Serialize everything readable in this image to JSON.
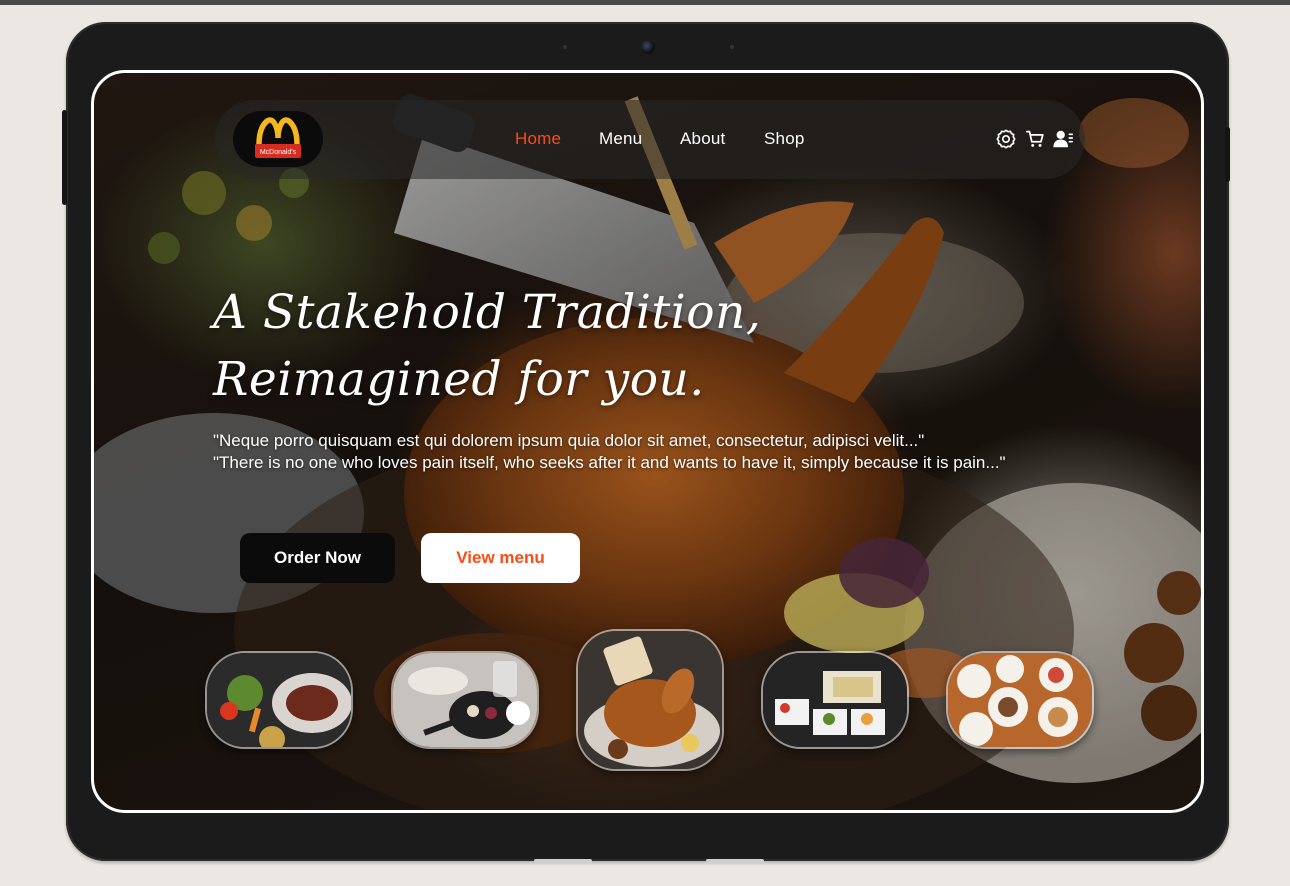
{
  "brand": {
    "logo_text": "McDonald's",
    "logo_icon": "golden-arches-icon"
  },
  "nav": {
    "items": [
      {
        "label": "Home",
        "active": true
      },
      {
        "label": "Menu",
        "active": false
      },
      {
        "label": "About",
        "active": false
      },
      {
        "label": "Shop",
        "active": false
      }
    ],
    "icons": [
      "settings-icon",
      "cart-icon",
      "user-icon"
    ]
  },
  "hero": {
    "title_line1": "A Stakehold Tradition,",
    "title_line2": "Reimagined for you.",
    "quote_line1": "\"Neque porro quisquam est qui dolorem ipsum quia dolor sit amet, consectetur, adipisci velit...\"",
    "quote_line2": "\"There is no one who loves pain itself, who seeks after it and wants to have it, simply because it is pain...\""
  },
  "actions": {
    "order_label": "Order Now",
    "view_label": "View menu"
  },
  "gallery": {
    "items": [
      "steak-salad-plate",
      "dessert-skillet",
      "roast-chicken",
      "sushi-trays",
      "shared-plates"
    ]
  },
  "colors": {
    "accent": "#ff4a14",
    "page_bg": "#ebe8e3",
    "device": "#1b1b1b"
  }
}
